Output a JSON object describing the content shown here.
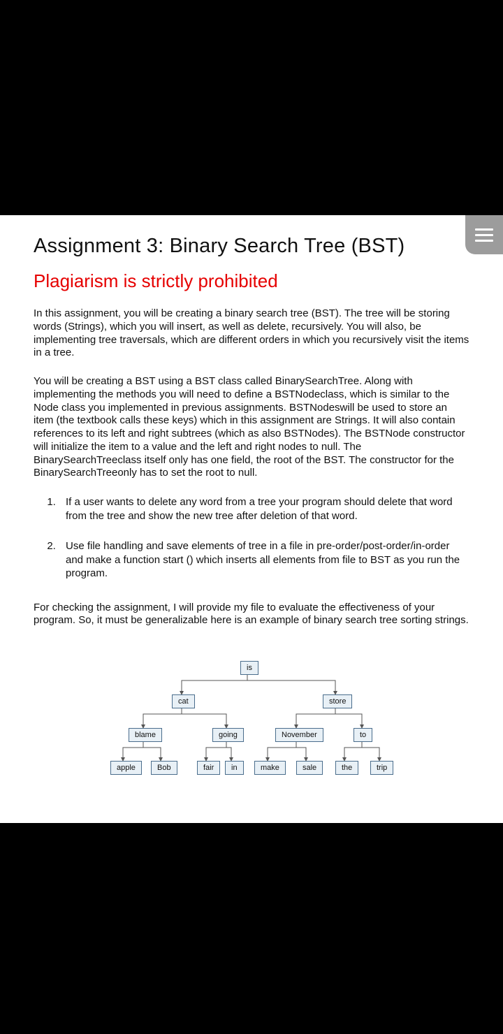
{
  "doc": {
    "title": "Assignment 3: Binary Search Tree (BST)",
    "warning": "Plagiarism is strictly prohibited",
    "p1": "In this assignment, you will be creating a binary search tree (BST). The tree will be storing words (Strings), which you will insert, as well as delete, recursively. You will also, be implementing tree traversals, which are different orders in which you recursively visit the items in a tree.",
    "p2": "You will be creating a BST using a BST class called BinarySearchTree. Along with implementing the methods you will need to define a BSTNodeclass, which is similar to the Node class you implemented in previous assignments. BSTNodeswill be used to store an item (the textbook calls these keys) which in this assignment are Strings. It will also contain references to its left and right subtrees (which as also BSTNodes). The BSTNode constructor will initialize the item to a value and the left and right nodes to null. The BinarySearchTreeclass itself only has one field, the root of the BST. The constructor for the BinarySearchTreeonly has to set the root to null.",
    "li1": "If a user wants to delete any word from a tree your program should delete that word from the tree and show the new tree after deletion of that word.",
    "li2": "Use file handling and save elements of tree in a file in pre-order/post-order/in-order and make a function start () which inserts all elements from file to BST as you run the program.",
    "p3": "For checking the assignment, I will provide my file to evaluate the effectiveness of your program. So, it must be generalizable here is an example of binary search tree sorting strings."
  },
  "tree": {
    "is": "is",
    "cat": "cat",
    "store": "store",
    "blame": "blame",
    "going": "going",
    "november": "November",
    "to": "to",
    "apple": "apple",
    "bob": "Bob",
    "fair": "fair",
    "in": "in",
    "make": "make",
    "sale": "sale",
    "the": "the",
    "trip": "trip"
  }
}
